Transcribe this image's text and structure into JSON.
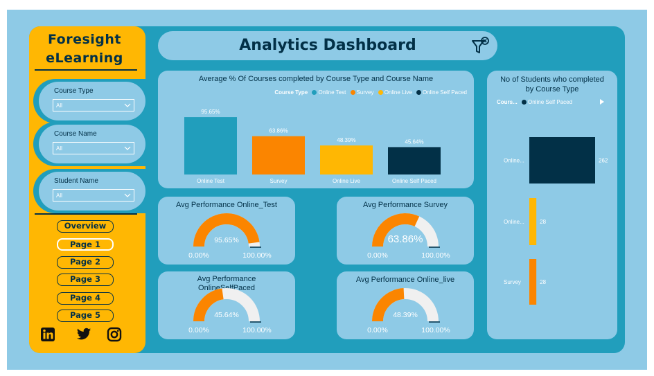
{
  "brand": {
    "line1": "Foresight",
    "line2": "eLearning"
  },
  "slicers": [
    {
      "label": "Course Type",
      "value": "All"
    },
    {
      "label": "Course Name",
      "value": "All"
    },
    {
      "label": "Student Name",
      "value": "All"
    }
  ],
  "nav": [
    {
      "label": "Overview",
      "active": false
    },
    {
      "label": "Page 1",
      "active": true
    },
    {
      "label": "Page 2",
      "active": false
    },
    {
      "label": "Page 3",
      "active": false
    },
    {
      "label": "Page 4",
      "active": false
    },
    {
      "label": "Page 5",
      "active": false
    }
  ],
  "social_icons": [
    "linkedin-icon",
    "twitter-icon",
    "instagram-icon"
  ],
  "header": {
    "title": "Analytics Dashboard",
    "icon": "clear-filter-icon"
  },
  "colors": {
    "navy": "#023047",
    "teal": "#219ebc",
    "light_blue": "#8ecae6",
    "amber": "#ffb703",
    "orange": "#fb8500",
    "gauge_track": "#f0f0f0"
  },
  "chart_data": [
    {
      "type": "bar",
      "title": "Average % Of Courses completed by Course Type and Course Name",
      "legend_title": "Course Type",
      "legend_position": "top-right",
      "categories": [
        "Online Test",
        "Survey",
        "Online Live",
        "Online Self Paced"
      ],
      "values": [
        95.65,
        63.86,
        48.39,
        45.64
      ],
      "value_labels": [
        "95.65%",
        "63.86%",
        "48.39%",
        "45.64%"
      ],
      "colors": [
        "#219ebc",
        "#fb8500",
        "#ffb703",
        "#023047"
      ]
    },
    {
      "type": "gauge",
      "title": "Avg Performance Online_Test",
      "value": 95.65,
      "min": 0,
      "max": 100,
      "value_label": "95.65%",
      "min_label": "0.00%",
      "max_label": "100.00%"
    },
    {
      "type": "gauge",
      "title": "Avg Performance Survey",
      "value": 63.86,
      "min": 0,
      "max": 100,
      "value_label": "63.86%",
      "min_label": "0.00%",
      "max_label": "100.00%"
    },
    {
      "type": "gauge",
      "title": "Avg Performance OnlineSelfPaced",
      "value": 45.64,
      "min": 0,
      "max": 100,
      "value_label": "45.64%",
      "min_label": "0.00%",
      "max_label": "100.00%"
    },
    {
      "type": "gauge",
      "title": "Avg Performance Online_live",
      "value": 48.39,
      "min": 0,
      "max": 100,
      "value_label": "48.39%",
      "min_label": "0.00%",
      "max_label": "100.00%"
    },
    {
      "type": "bar",
      "orientation": "vertical-stacked-by-row",
      "title": "No of Students who completed by Course Type",
      "legend_title": "Cours...",
      "legend_items": [
        "Online Self Paced"
      ],
      "categories": [
        "Online...",
        "Online...",
        "Survey"
      ],
      "values": [
        262,
        28,
        28
      ],
      "colors": [
        "#023047",
        "#ffb703",
        "#fb8500"
      ]
    }
  ]
}
